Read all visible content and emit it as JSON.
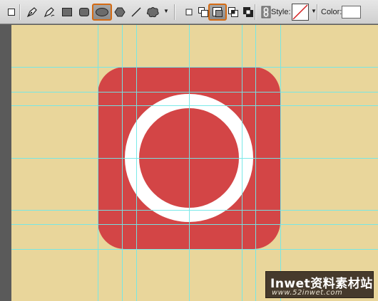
{
  "toolbar": {
    "tools": [
      {
        "name": "pen-tool"
      },
      {
        "name": "freeform-pen-tool"
      },
      {
        "name": "rectangle-tool"
      },
      {
        "name": "rounded-rectangle-tool"
      },
      {
        "name": "ellipse-tool",
        "selected": true
      },
      {
        "name": "polygon-tool"
      },
      {
        "name": "line-tool"
      },
      {
        "name": "custom-shape-tool"
      }
    ],
    "path_operations": [
      {
        "name": "new-layer"
      },
      {
        "name": "add-to-shape"
      },
      {
        "name": "subtract-from-shape",
        "selected": true
      },
      {
        "name": "intersect-shape"
      },
      {
        "name": "exclude-overlap"
      }
    ],
    "style_label": "Style:",
    "color_label": "Color:",
    "color_value": "#ffffff",
    "selected_outline": "#d46a12"
  },
  "canvas": {
    "background": "#e9d69b",
    "guide_color": "#73e8e8",
    "icon_color": "#d34546",
    "ring_color": "#ffffff"
  },
  "watermark": {
    "line1": "Inwet资料素材站",
    "line2": "www.52inwet.com"
  }
}
